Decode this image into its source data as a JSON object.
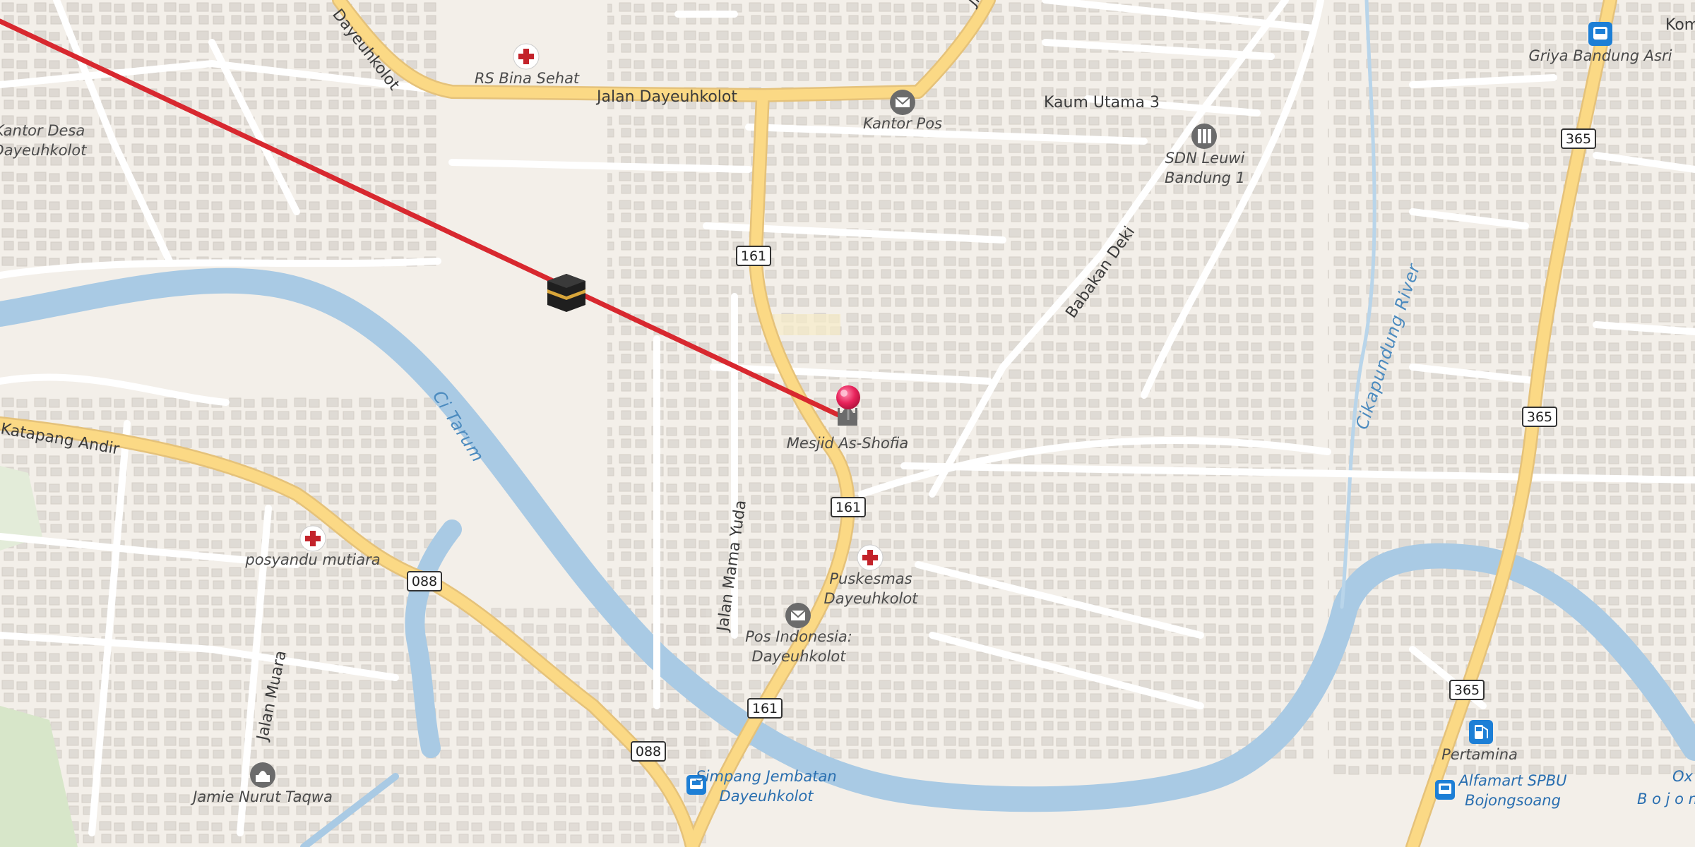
{
  "map": {
    "streets": {
      "jalan_dayeuhkolot": "Jalan Dayeuhkolot",
      "dayeuhkolot_nw": "Dayeuhkolot",
      "kaum_utama_3": "Kaum Utama 3",
      "babakan_deki": "Babakan Deki",
      "jalan_mama_yuda": "Jalan Mama Yuda",
      "katapang_andir": "Katapang Andir",
      "jalan_muara": "Jalan Muara",
      "top_cut": "Jl",
      "kom_cut": "Kom"
    },
    "water": {
      "ci_tarum": "Ci Tarum",
      "cikapundung_river": "Cikapundung River"
    },
    "pois": {
      "kantor_desa_line1": "Kantor Desa",
      "kantor_desa_line2": "Dayeuhkolot",
      "rs_bina_sehat": "RS Bina Sehat",
      "kantor_pos": "Kantor Pos",
      "sdn_line1": "SDN Leuwi",
      "sdn_line2": "Bandung 1",
      "griya": "Griya Bandung Asri",
      "mesjid": "Mesjid As-Shofia",
      "puskesmas_line1": "Puskesmas",
      "puskesmas_line2": "Dayeuhkolot",
      "pos_indonesia_line1": "Pos Indonesia:",
      "pos_indonesia_line2": "Dayeuhkolot",
      "posyandu": "posyandu mutiara",
      "jamie": "Jamie Nurut Taqwa",
      "simpang_line1": "Simpang Jembatan",
      "simpang_line2": "Dayeuhkolot",
      "pertamina": "Pertamina",
      "alfamart_line1": "Alfamart SPBU",
      "alfamart_line2": "Bojongsoang",
      "ox_cut": "Ox",
      "bojong_cut": "B o j o n"
    },
    "shields": {
      "r161_a": "161",
      "r161_b": "161",
      "r161_c": "161",
      "r365_a": "365",
      "r365_b": "365",
      "r365_c": "365",
      "r088_a": "088",
      "r088_b": "088"
    },
    "icons": [
      "kaaba-icon",
      "hospital-icon",
      "mail-icon",
      "school-icon",
      "bus-stop-icon",
      "mosque-icon",
      "fuel-icon",
      "location-pin-icon"
    ],
    "colors": {
      "background": "#f3efe9",
      "water": "#a9cae4",
      "major_road": "#fbd985",
      "road_casing": "#e5c27a",
      "minor_road": "#ffffff",
      "building": "#dcd7d1",
      "qibla_line": "#d8282f",
      "pin": "#e8235b",
      "hospital": "#c3232b",
      "bus": "#1d7fd6"
    }
  }
}
